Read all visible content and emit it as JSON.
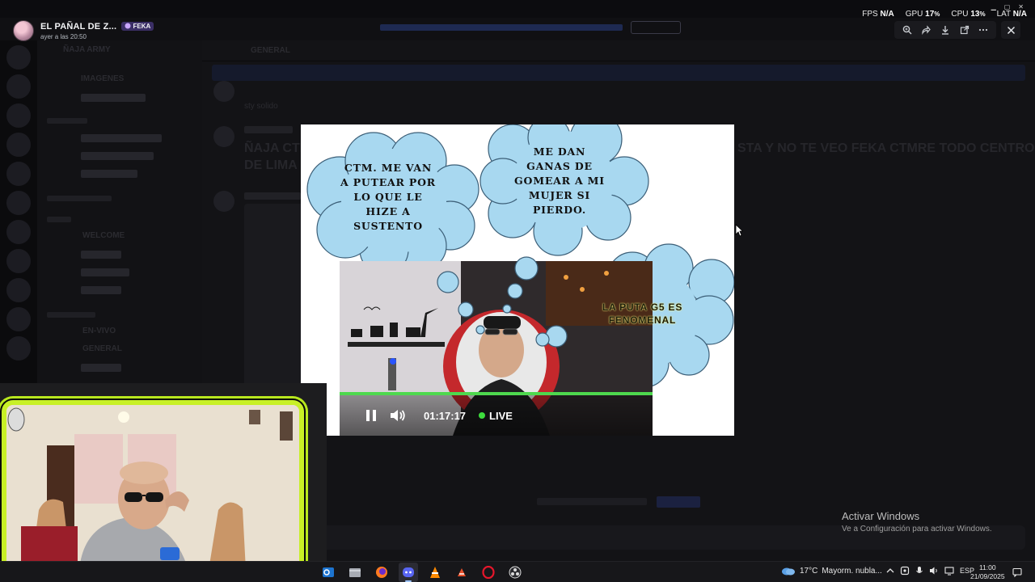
{
  "viewer": {
    "user_name": "EL PAÑAL DE Z...",
    "badge": "FEKA",
    "timestamp": "ayer a las 20:50",
    "tools": [
      "zoom-icon",
      "forward-icon",
      "download-icon",
      "open-external-icon",
      "more-icon"
    ],
    "close_icon": "close-icon"
  },
  "overlay_stats": {
    "fps_label": "FPS",
    "fps_value": "N/A",
    "gpu_label": "GPU",
    "gpu_value": "17",
    "cpu_label": "CPU",
    "cpu_value": "13",
    "lat_label": "LAT",
    "lat_value": "N/A",
    "percent": "%"
  },
  "meme": {
    "cloud1": "CTM. ME VAN\nA PUTEAR POR\nLO QUE LE\nHIZE A\nSUSTENTO",
    "cloud2": "ME DAN\nGANAS DE\nGOMEAR A MI\nMUJER SI\nPIERDO.",
    "cloud3": "LA PUTA G5 ES\nFENOMENAL",
    "cloud_color": "#a8d8f0",
    "stream": {
      "time": "01:17:17",
      "live_label": "LIVE",
      "progress_color": "#4ed84e"
    }
  },
  "background": {
    "server_name": "ÑAJA ARMY",
    "channel_title": "GENERAL",
    "channels": [
      "IMAGENES",
      "WELCOME",
      "EN-VIVO",
      "GENERAL"
    ],
    "big_message": "ÑAJA CTM",
    "big_message_line2": "DE LIMA",
    "big_message_right": "STA Y NO TE VEO FEKA CTMRE TODO CENTRO",
    "message_text_1": "sty solido"
  },
  "watermark": {
    "title": "Activar Windows",
    "subtitle": "Ve a Configuración para activar Windows."
  },
  "taskbar": {
    "apps": [
      "outlook-icon",
      "file-explorer-icon",
      "firefox-icon",
      "discord-icon",
      "vlc-icon",
      "app-icon",
      "opera-icon",
      "obs-icon"
    ],
    "weather_temp": "17°C",
    "weather_desc": "Mayorm. nubla...",
    "language": "ESP",
    "time": "11:00",
    "date": "21/09/2025"
  }
}
